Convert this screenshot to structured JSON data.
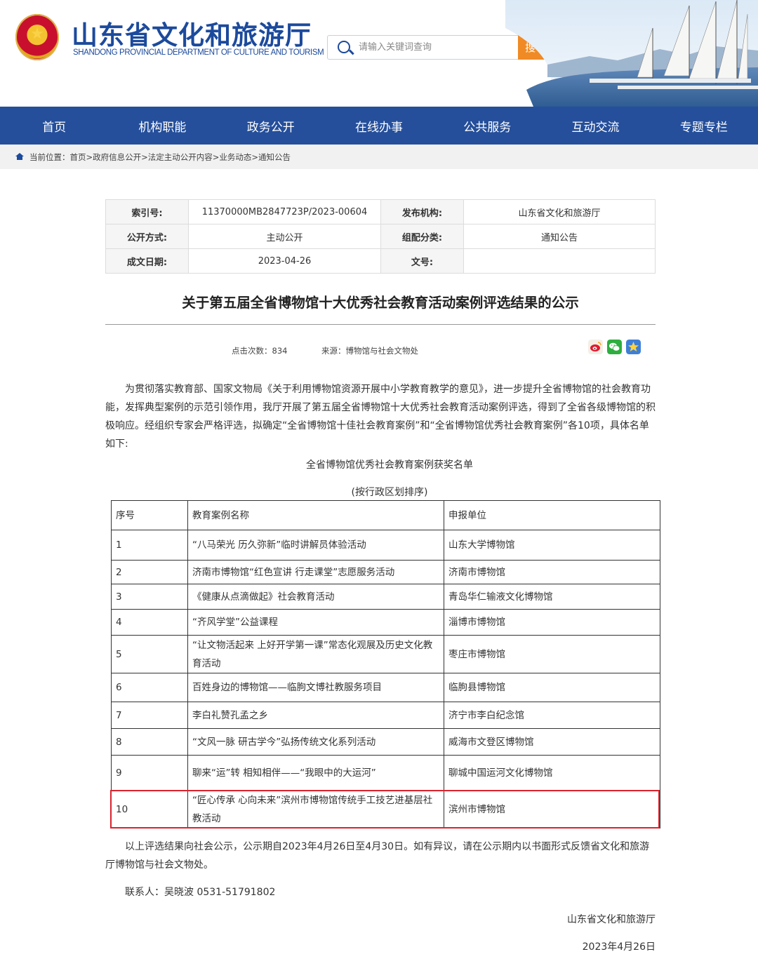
{
  "header": {
    "title": "山东省文化和旅游厅",
    "subtitle": "SHANDONG PROVINCIAL DEPARTMENT OF CULTURE AND TOURISM",
    "search_placeholder": "请输入关键词查询",
    "search_button": "搜 索"
  },
  "nav": [
    "首页",
    "机构职能",
    "政务公开",
    "在线办事",
    "公共服务",
    "互动交流",
    "专题专栏"
  ],
  "breadcrumb": "当前位置：首页>政府信息公开>法定主动公开内容>业务动态>通知公告",
  "meta": {
    "index_label": "索引号:",
    "index_value": "11370000MB2847723P/2023-00604",
    "publisher_label": "发布机构:",
    "publisher_value": "山东省文化和旅游厅",
    "mode_label": "公开方式:",
    "mode_value": "主动公开",
    "category_label": "组配分类:",
    "category_value": "通知公告",
    "date_label": "成文日期:",
    "date_value": "2023-04-26",
    "docno_label": "文号:",
    "docno_value": ""
  },
  "article": {
    "title": "关于第五届全省博物馆十大优秀社会教育活动案例评选结果的公示",
    "clicks_label": "点击次数：",
    "clicks": "834",
    "source_label": "来源：",
    "source": "博物馆与社会文物处",
    "intro": "为贯彻落实教育部、国家文物局《关于利用博物馆资源开展中小学教育教学的意见》，进一步提升全省博物馆的社会教育功能，发挥典型案例的示范引领作用，我厅开展了第五届全省博物馆十大优秀社会教育活动案例评选，得到了全省各级博物馆的积极响应。经组织专家会严格评选，拟确定“全省博物馆十佳社会教育案例”和“全省博物馆优秀社会教育案例”各10项，具体名单如下:",
    "list_title": "全省博物馆优秀社会教育案例获奖名单",
    "list_note": "(按行政区划排序)",
    "closing": "以上评选结果向社会公示，公示期自2023年4月26日至4月30日。如有异议，请在公示期内以书面形式反馈省文化和旅游厅博物馆与社会文物处。",
    "contact": "联系人：吴晓波  0531-51791802",
    "signature": "山东省文化和旅游厅",
    "sign_date": "2023年4月26日"
  },
  "table": {
    "headers": [
      "序号",
      "教育案例名称",
      "申报单位"
    ],
    "rows": [
      [
        "1",
        "“八马荣光 历久弥新”临时讲解员体验活动",
        "山东大学博物馆"
      ],
      [
        "2",
        "济南市博物馆“红色宣讲 行走课堂”志愿服务活动",
        "济南市博物馆"
      ],
      [
        "3",
        "《健康从点滴做起》社会教育活动",
        "青岛华仁输液文化博物馆"
      ],
      [
        "4",
        "“齐风学堂”公益课程",
        "淄博市博物馆"
      ],
      [
        "5",
        "“让文物活起来 上好开学第一课”常态化观展及历史文化教育活动",
        "枣庄市博物馆"
      ],
      [
        "6",
        "百姓身边的博物馆——临朐文博社教服务项目",
        "临朐县博物馆"
      ],
      [
        "7",
        "李白礼赞孔孟之乡",
        "济宁市李白纪念馆"
      ],
      [
        "8",
        "“文风一脉 研古学今”弘扬传统文化系列活动",
        "威海市文登区博物馆"
      ],
      [
        "9",
        "聊来“运”转 相知相伴——“我眼中的大运河”",
        "聊城中国运河文化博物馆"
      ],
      [
        "10",
        "“匠心传承 心向未来”滨州市博物馆传统手工技艺进基层社教活动",
        "滨州市博物馆"
      ]
    ]
  },
  "colors": {
    "brand_blue": "#254f9b",
    "accent_orange": "#f08a24",
    "highlight_red": "#d9232d"
  },
  "icons": [
    "search-icon",
    "home-icon",
    "weibo-icon",
    "wechat-icon",
    "favorite-icon"
  ]
}
